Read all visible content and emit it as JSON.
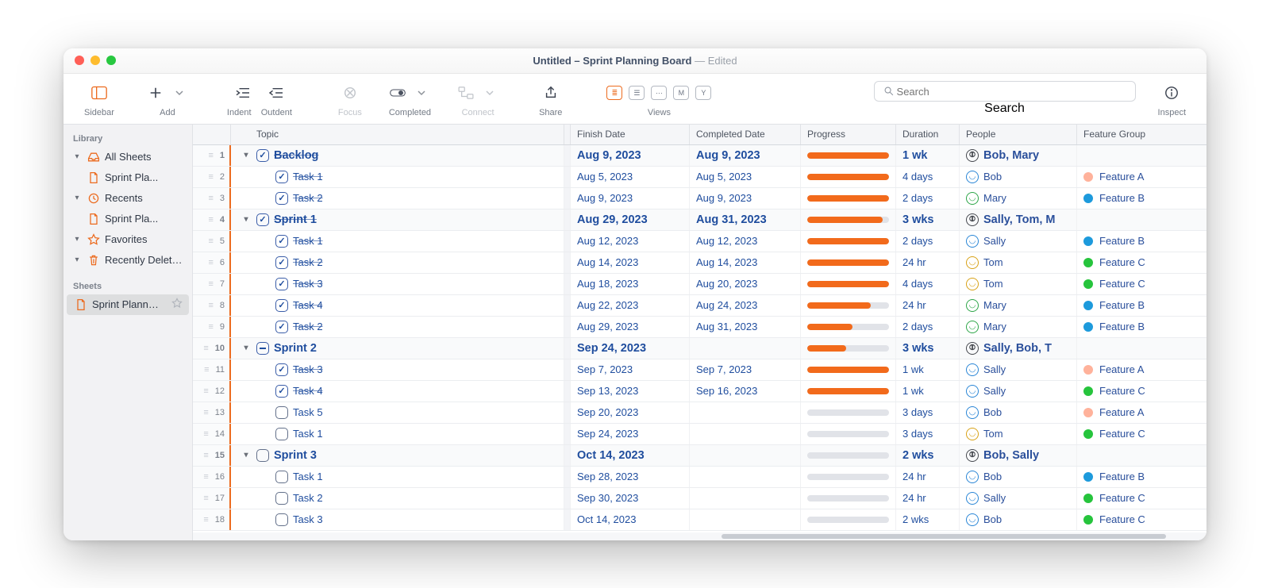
{
  "title": {
    "main": "Untitled – Sprint Planning Board",
    "suffix": "— Edited"
  },
  "toolbar": {
    "sidebar": "Sidebar",
    "add": "Add",
    "indent": "Indent",
    "outdent": "Outdent",
    "focus": "Focus",
    "completed": "Completed",
    "connect": "Connect",
    "share": "Share",
    "views": "Views",
    "search": "Search",
    "inspect": "Inspect",
    "search_placeholder": "Search"
  },
  "sidebar": {
    "library": "Library",
    "all_sheets": "All Sheets",
    "all_sheets_item": "Sprint Pla...",
    "recents": "Recents",
    "recents_item": "Sprint Pla...",
    "favorites": "Favorites",
    "recently_deleted": "Recently Delet…",
    "sheets": "Sheets",
    "sheet_item": "Sprint Plann…"
  },
  "columns": {
    "topic": "Topic",
    "finish": "Finish Date",
    "completed": "Completed Date",
    "progress": "Progress",
    "duration": "Duration",
    "people": "People",
    "feature": "Feature Group"
  },
  "rows": [
    {
      "n": "1",
      "indent": 1,
      "disc": true,
      "check": "done",
      "strike": true,
      "group": true,
      "topic": "Backlog",
      "finish": "Aug 9, 2023",
      "completed": "Aug 9, 2023",
      "progress": 100,
      "duration": "1 wk",
      "people": "Bob, Mary",
      "picon": "multi",
      "feature": ""
    },
    {
      "n": "2",
      "indent": 2,
      "disc": false,
      "check": "done",
      "strike": true,
      "group": false,
      "topic": "Task 1",
      "finish": "Aug 5, 2023",
      "completed": "Aug 5, 2023",
      "progress": 100,
      "duration": "4 days",
      "people": "Bob",
      "picon": "blue",
      "feature": "A"
    },
    {
      "n": "3",
      "indent": 2,
      "disc": false,
      "check": "done",
      "strike": true,
      "group": false,
      "topic": "Task 2",
      "finish": "Aug 9, 2023",
      "completed": "Aug 9, 2023",
      "progress": 100,
      "duration": "2 days",
      "people": "Mary",
      "picon": "green",
      "feature": "B"
    },
    {
      "n": "4",
      "indent": 1,
      "disc": true,
      "check": "done",
      "strike": true,
      "group": true,
      "topic": "Sprint 1",
      "finish": "Aug 29, 2023",
      "completed": "Aug 31, 2023",
      "progress": 92,
      "duration": "3 wks",
      "people": "Sally, Tom, M",
      "picon": "multi",
      "feature": ""
    },
    {
      "n": "5",
      "indent": 2,
      "disc": false,
      "check": "done",
      "strike": true,
      "group": false,
      "topic": "Task 1",
      "finish": "Aug 12, 2023",
      "completed": "Aug 12, 2023",
      "progress": 100,
      "duration": "2 days",
      "people": "Sally",
      "picon": "blue",
      "feature": "B"
    },
    {
      "n": "6",
      "indent": 2,
      "disc": false,
      "check": "done",
      "strike": true,
      "group": false,
      "topic": "Task 2",
      "finish": "Aug 14, 2023",
      "completed": "Aug 14, 2023",
      "progress": 100,
      "duration": "24 hr",
      "people": "Tom",
      "picon": "yellow",
      "feature": "C"
    },
    {
      "n": "7",
      "indent": 2,
      "disc": false,
      "check": "done",
      "strike": true,
      "group": false,
      "topic": "Task 3",
      "finish": "Aug 18, 2023",
      "completed": "Aug 20, 2023",
      "progress": 100,
      "duration": "4 days",
      "people": "Tom",
      "picon": "yellow",
      "feature": "C"
    },
    {
      "n": "8",
      "indent": 2,
      "disc": false,
      "check": "done",
      "strike": true,
      "group": false,
      "topic": "Task 4",
      "finish": "Aug 22, 2023",
      "completed": "Aug 24, 2023",
      "progress": 78,
      "duration": "24 hr",
      "people": "Mary",
      "picon": "green",
      "feature": "B"
    },
    {
      "n": "9",
      "indent": 2,
      "disc": false,
      "check": "done",
      "strike": true,
      "group": false,
      "topic": "Task 2",
      "finish": "Aug 29, 2023",
      "completed": "Aug 31, 2023",
      "progress": 55,
      "duration": "2 days",
      "people": "Mary",
      "picon": "green",
      "feature": "B"
    },
    {
      "n": "10",
      "indent": 1,
      "disc": true,
      "check": "dash",
      "strike": false,
      "group": true,
      "topic": "Sprint 2",
      "finish": "Sep 24, 2023",
      "completed": "",
      "progress": 48,
      "duration": "3 wks",
      "people": "Sally, Bob, T",
      "picon": "multi",
      "feature": ""
    },
    {
      "n": "11",
      "indent": 2,
      "disc": false,
      "check": "done",
      "strike": true,
      "group": false,
      "topic": "Task 3",
      "finish": "Sep 7, 2023",
      "completed": "Sep 7, 2023",
      "progress": 100,
      "duration": "1 wk",
      "people": "Sally",
      "picon": "blue",
      "feature": "A"
    },
    {
      "n": "12",
      "indent": 2,
      "disc": false,
      "check": "done",
      "strike": true,
      "group": false,
      "topic": "Task 4",
      "finish": "Sep 13, 2023",
      "completed": "Sep 16, 2023",
      "progress": 100,
      "duration": "1 wk",
      "people": "Sally",
      "picon": "blue",
      "feature": "C"
    },
    {
      "n": "13",
      "indent": 2,
      "disc": false,
      "check": "empty",
      "strike": false,
      "group": false,
      "topic": "Task 5",
      "finish": "Sep 20, 2023",
      "completed": "",
      "progress": 0,
      "duration": "3 days",
      "people": "Bob",
      "picon": "blue",
      "feature": "A"
    },
    {
      "n": "14",
      "indent": 2,
      "disc": false,
      "check": "empty",
      "strike": false,
      "group": false,
      "topic": "Task 1",
      "finish": "Sep 24, 2023",
      "completed": "",
      "progress": 0,
      "duration": "3 days",
      "people": "Tom",
      "picon": "yellow",
      "feature": "C"
    },
    {
      "n": "15",
      "indent": 1,
      "disc": true,
      "check": "empty",
      "strike": false,
      "group": true,
      "topic": "Sprint 3",
      "finish": "Oct 14, 2023",
      "completed": "",
      "progress": 0,
      "duration": "2 wks",
      "people": "Bob, Sally",
      "picon": "multi",
      "feature": ""
    },
    {
      "n": "16",
      "indent": 2,
      "disc": false,
      "check": "empty",
      "strike": false,
      "group": false,
      "topic": "Task 1",
      "finish": "Sep 28, 2023",
      "completed": "",
      "progress": 0,
      "duration": "24 hr",
      "people": "Bob",
      "picon": "blue",
      "feature": "B"
    },
    {
      "n": "17",
      "indent": 2,
      "disc": false,
      "check": "empty",
      "strike": false,
      "group": false,
      "topic": "Task 2",
      "finish": "Sep 30, 2023",
      "completed": "",
      "progress": 0,
      "duration": "24 hr",
      "people": "Sally",
      "picon": "blue",
      "feature": "C"
    },
    {
      "n": "18",
      "indent": 2,
      "disc": false,
      "check": "empty",
      "strike": false,
      "group": false,
      "topic": "Task 3",
      "finish": "Oct 14, 2023",
      "completed": "",
      "progress": 0,
      "duration": "2 wks",
      "people": "Bob",
      "picon": "blue",
      "feature": "C"
    }
  ],
  "features": {
    "A": "Feature A",
    "B": "Feature B",
    "C": "Feature C"
  }
}
